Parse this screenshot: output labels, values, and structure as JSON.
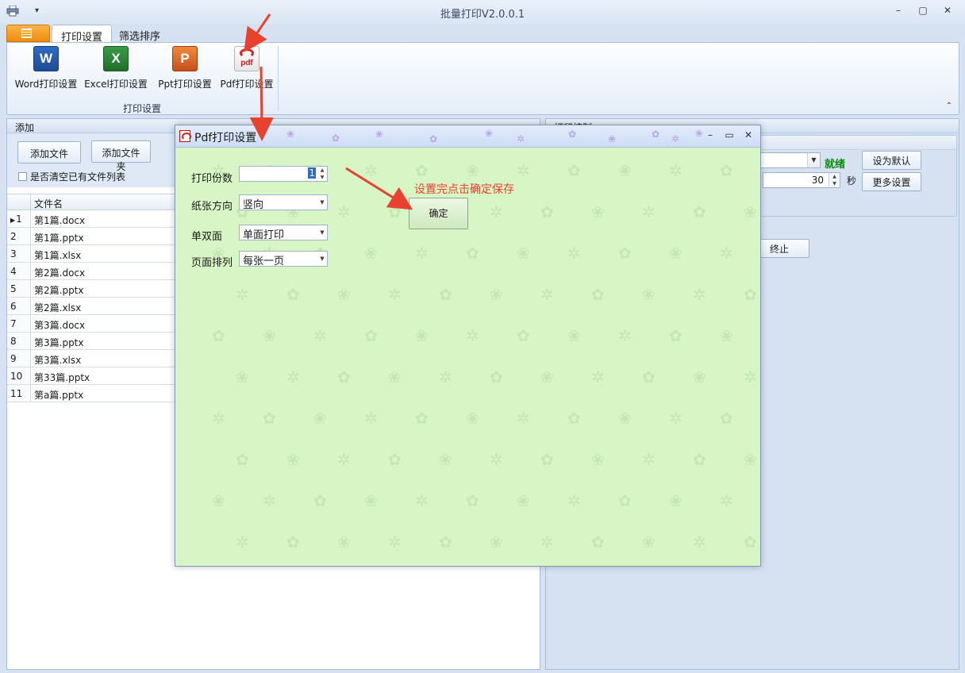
{
  "window": {
    "title": "批量打印V2.0.0.1",
    "controls": {
      "minimize": "–",
      "restore": "▢",
      "close": "✕"
    }
  },
  "ribbon": {
    "tabs": [
      {
        "label": "打印设置"
      },
      {
        "label": "筛选排序"
      }
    ],
    "buttons": [
      {
        "label": "Word打印设置",
        "icon": "word-icon",
        "letter": "W"
      },
      {
        "label": "Excel打印设置",
        "icon": "excel-icon",
        "letter": "X"
      },
      {
        "label": "Ppt打印设置",
        "icon": "ppt-icon",
        "letter": "P"
      },
      {
        "label": "Pdf打印设置",
        "icon": "pdf-icon",
        "letter": "pdf"
      }
    ],
    "group_label": "打印设置"
  },
  "left": {
    "section_title": "添加",
    "add_file": "添加文件",
    "add_folder": "添加文件夹",
    "clear_checkbox": "是否清空已有文件列表",
    "grid_header": "文件名",
    "files": [
      {
        "n": "1",
        "name": "第1篇.docx"
      },
      {
        "n": "2",
        "name": "第1篇.pptx"
      },
      {
        "n": "3",
        "name": "第1篇.xlsx"
      },
      {
        "n": "4",
        "name": "第2篇.docx"
      },
      {
        "n": "5",
        "name": "第2篇.pptx"
      },
      {
        "n": "6",
        "name": "第2篇.xlsx"
      },
      {
        "n": "7",
        "name": "第3篇.docx"
      },
      {
        "n": "8",
        "name": "第3篇.pptx"
      },
      {
        "n": "9",
        "name": "第3篇.xlsx"
      },
      {
        "n": "10",
        "name": "第33篇.pptx"
      },
      {
        "n": "11",
        "name": "第a篇.pptx"
      }
    ]
  },
  "right": {
    "section_title": "打印控制",
    "status": "就绪",
    "set_default": "设为默认",
    "seconds_value": "30",
    "seconds_unit": "秒",
    "more_settings": "更多设置",
    "stop": "终止"
  },
  "dialog": {
    "title": "Pdf打印设置",
    "copies_label": "打印份数",
    "copies_value": "1",
    "orientation_label": "纸张方向",
    "orientation_value": "竖向",
    "duplex_label": "单双面",
    "duplex_value": "单面打印",
    "pages_label": "页面排列",
    "pages_value": "每张一页",
    "ok": "确定",
    "hint": "设置完点击确定保存"
  },
  "colors": {
    "accent": "#e8422f",
    "dialog_bg": "#d8f5c6",
    "status_ready": "#0b8a0b"
  }
}
